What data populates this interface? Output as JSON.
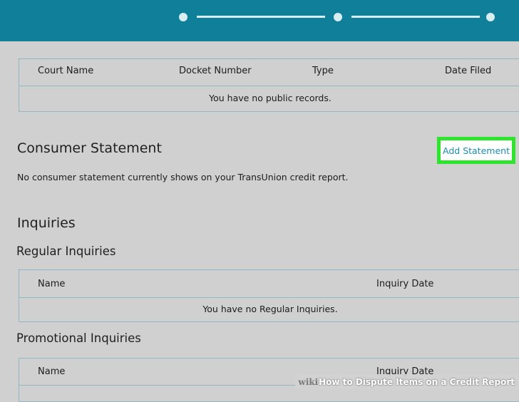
{
  "progress": {
    "steps": 3,
    "current": 1
  },
  "public_records": {
    "columns": [
      "Court Name",
      "Docket Number",
      "Type",
      "Date Filed"
    ],
    "empty_message": "You have no public records."
  },
  "consumer_statement": {
    "title": "Consumer Statement",
    "add_button": "Add Statement",
    "message": "No consumer statement currently shows on your TransUnion credit report."
  },
  "inquiries": {
    "title": "Inquiries",
    "regular": {
      "title": "Regular Inquiries",
      "columns": [
        "Name",
        "Inquiry Date"
      ],
      "empty_message": "You have no Regular Inquiries."
    },
    "promotional": {
      "title": "Promotional Inquiries",
      "columns": [
        "Name",
        "Inquiry Date"
      ]
    }
  },
  "watermark": {
    "brand": "wiki",
    "text": "How to Dispute Items on a Credit Report"
  },
  "colors": {
    "header": "#0f7f9a",
    "highlight": "#2de52d",
    "link": "#1a8db0",
    "background": "#d0d0d0"
  }
}
